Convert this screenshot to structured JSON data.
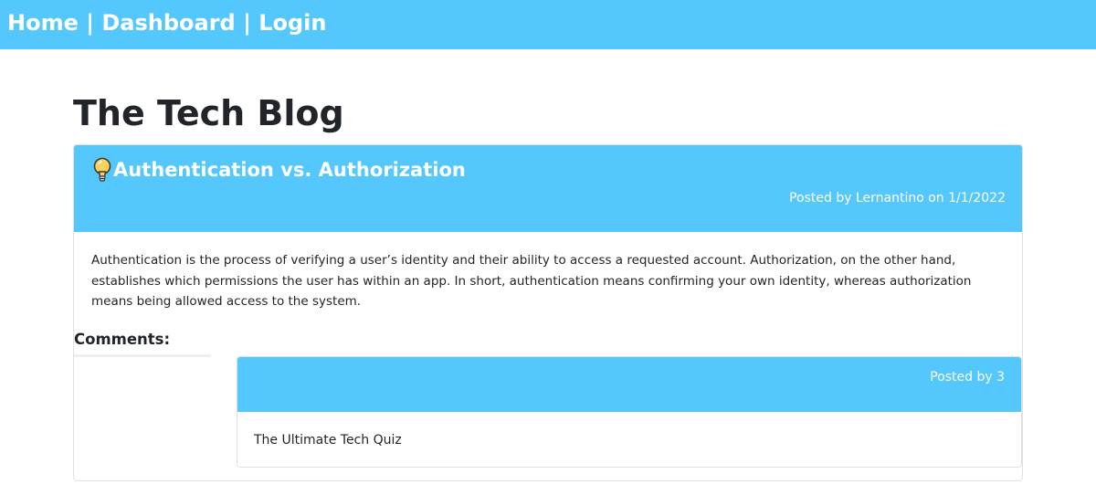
{
  "nav": {
    "home": "Home",
    "dashboard": "Dashboard",
    "login": "Login",
    "separator": "|"
  },
  "page": {
    "title": "The Tech Blog"
  },
  "post": {
    "icon": "lightbulb-icon",
    "title": "Authentication vs. Authorization",
    "meta": "Posted by Lernantino on 1/1/2022",
    "body": "Authentication is the process of verifying a user’s identity and their ability to access a requested account. Authorization, on the other hand, establishes which permissions the user has within an app. In short, authentication means confirming your own identity, whereas authorization means being allowed access to the system."
  },
  "comments": {
    "heading": "Comments:",
    "items": [
      {
        "meta": "Posted by 3",
        "body": "The Ultimate Tech Quiz"
      }
    ]
  },
  "colors": {
    "accent": "#54c7fc",
    "text": "#212529",
    "border": "#e0e0e0"
  }
}
